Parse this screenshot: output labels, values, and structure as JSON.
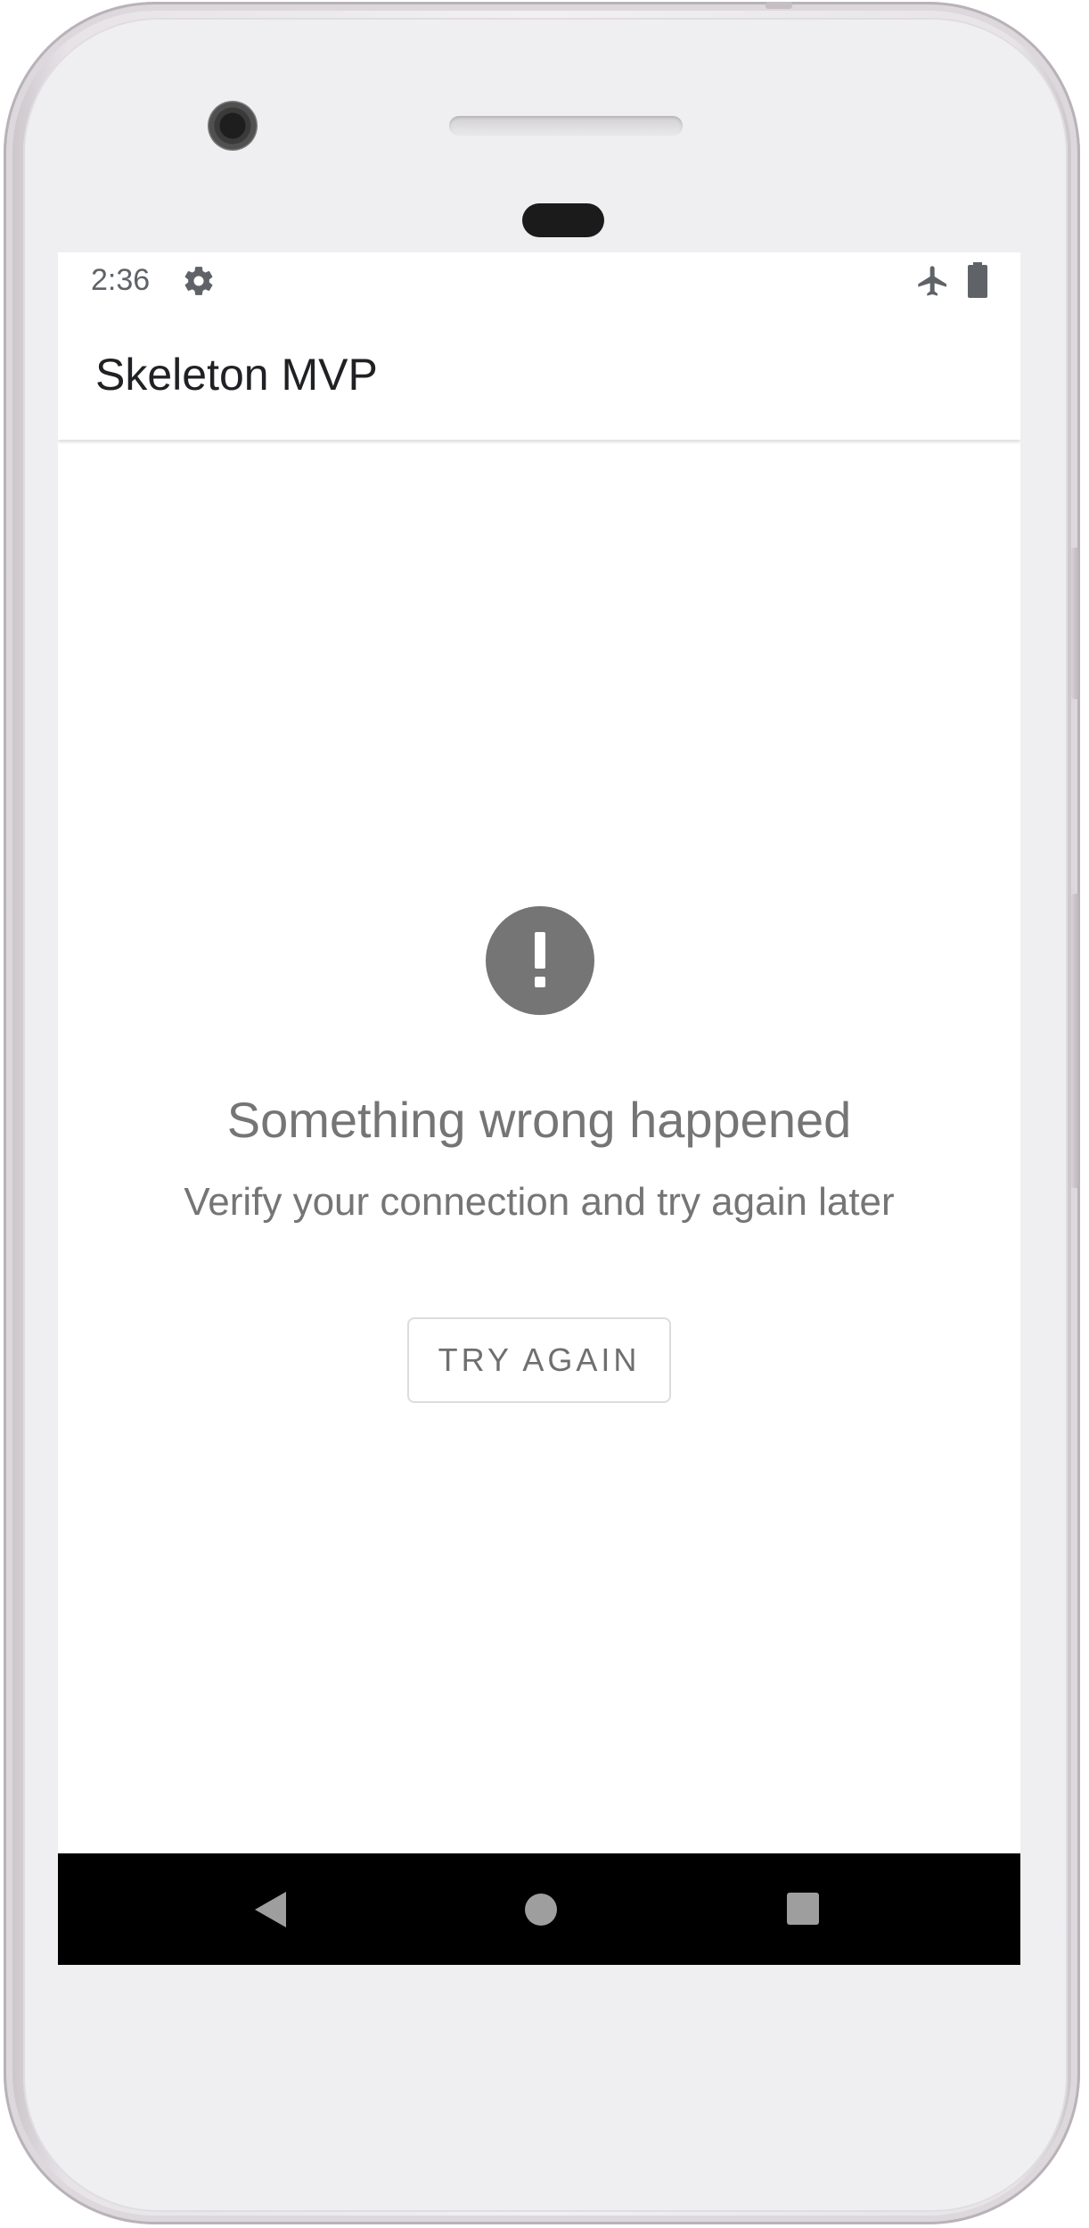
{
  "status_bar": {
    "time": "2:36",
    "icons": [
      "gear-icon",
      "airplane-mode-icon",
      "battery-icon"
    ]
  },
  "app_bar": {
    "title": "Skeleton MVP"
  },
  "error_state": {
    "icon": "exclamation-circle-icon",
    "title": "Something wrong happened",
    "message": "Verify your connection and try again later",
    "retry_label": "TRY AGAIN"
  },
  "navigation_bar": {
    "icons": [
      "back-icon",
      "home-icon",
      "recents-icon"
    ]
  },
  "colors": {
    "icon_gray": "#757575",
    "text_gray": "#757575",
    "nav_background": "#000000",
    "nav_icon": "#9e9e9e"
  }
}
